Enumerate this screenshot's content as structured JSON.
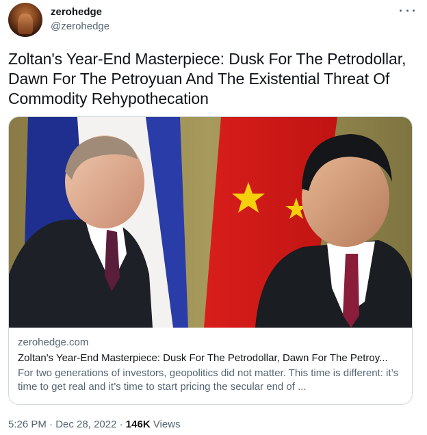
{
  "author": {
    "display_name": "zerohedge",
    "handle": "@zerohedge"
  },
  "menu_icon": "more-horizontal-icon",
  "tweet": {
    "text": "Zoltan's Year-End Masterpiece: Dusk For The Petrodollar, Dawn For The Petroyuan And The Existential Threat Of Commodity Rehypothecation"
  },
  "card": {
    "domain": "zerohedge.com",
    "title": "Zoltan's Year-End Masterpiece: Dusk For The Petrodollar, Dawn For The Petroy...",
    "description": "For two generations of investors, geopolitics did not matter. This time is different: it’s time to get real and it’s time to start pricing the secular end of ..."
  },
  "meta": {
    "time": "5:26 PM",
    "separator": "·",
    "date": "Dec 28, 2022",
    "views_count": "146K",
    "views_label": "Views"
  },
  "colors": {
    "primary_text": "#0f1419",
    "secondary_text": "#536471",
    "border": "#cfd9de"
  }
}
